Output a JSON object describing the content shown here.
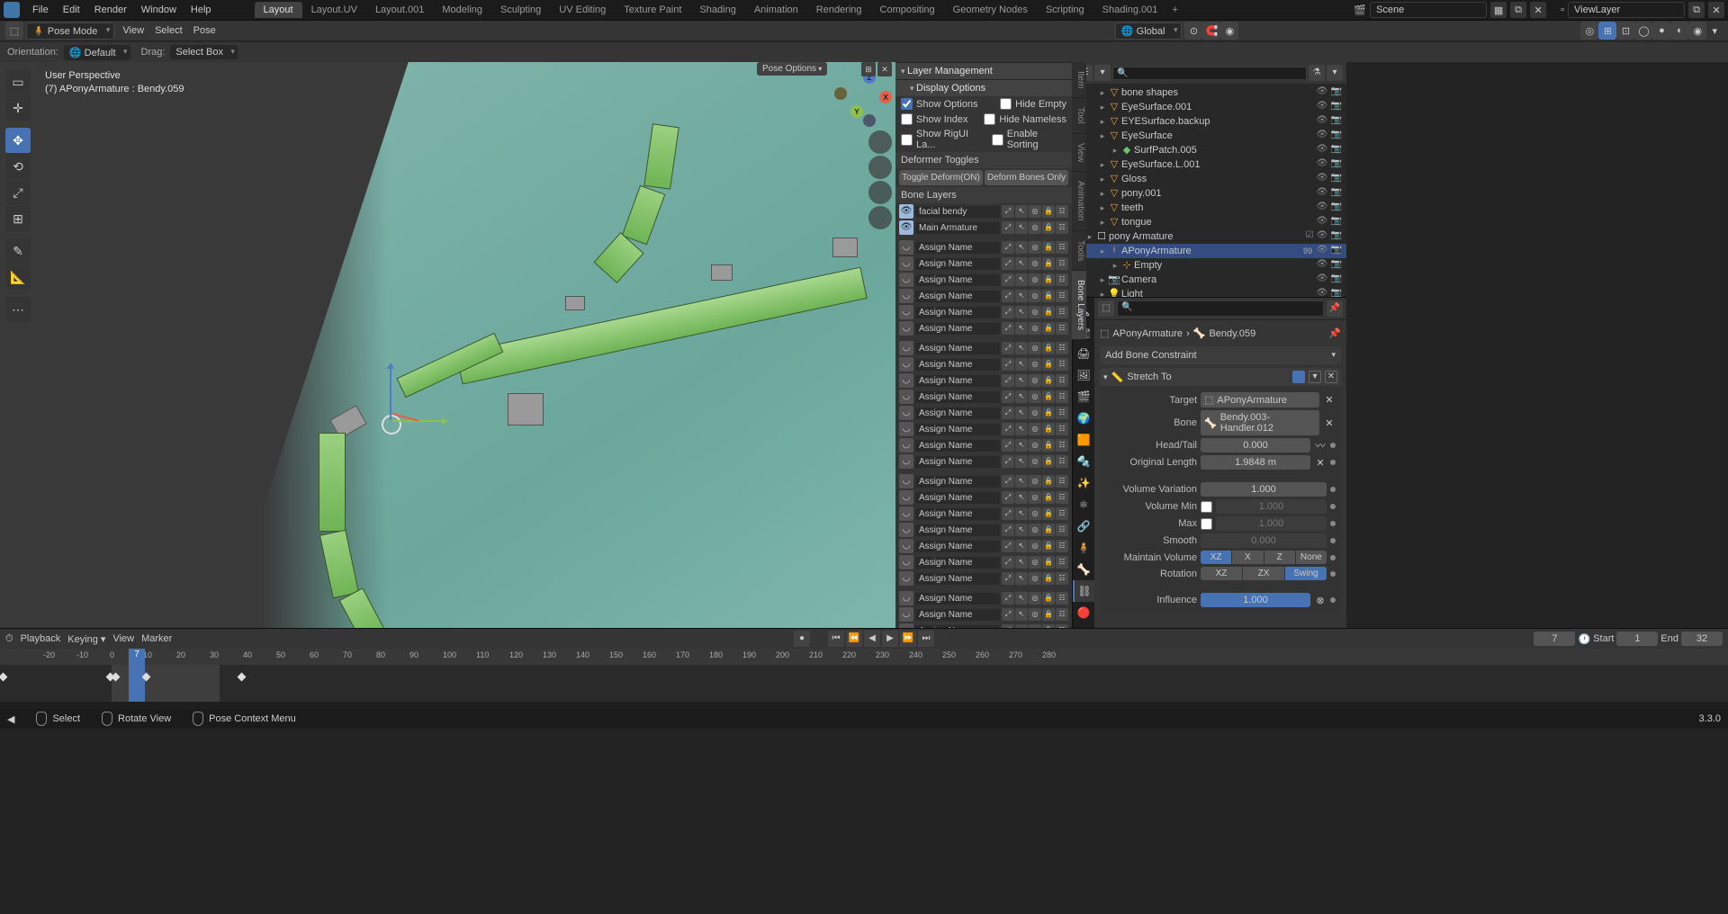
{
  "menu": {
    "file": "File",
    "edit": "Edit",
    "render": "Render",
    "window": "Window",
    "help": "Help"
  },
  "workspaces": {
    "tabs": [
      "Layout",
      "Layout.UV",
      "Layout.001",
      "Modeling",
      "Sculpting",
      "UV Editing",
      "Texture Paint",
      "Shading",
      "Animation",
      "Rendering",
      "Compositing",
      "Geometry Nodes",
      "Scripting",
      "Shading.001"
    ],
    "active": 0
  },
  "scene_name": "Scene",
  "viewlayer_name": "ViewLayer",
  "hdr": {
    "mode": "Pose Mode",
    "view": "View",
    "select": "Select",
    "pose": "Pose",
    "global": "Global"
  },
  "sub": {
    "orientation_lbl": "Orientation:",
    "orientation": "Default",
    "drag_lbl": "Drag:",
    "drag": "Select Box"
  },
  "vp": {
    "persp": "User Perspective",
    "obj": "(7) APonyArmature : Bendy.059"
  },
  "npanel": {
    "close": "✕",
    "pose_opt": "Pose Options",
    "layer_mgmt": "Layer Management",
    "display_opt": "Display Options",
    "show_options": "Show Options",
    "show_index": "Show Index",
    "show_rigui": "Show RigUI La...",
    "hide_empty": "Hide Empty",
    "hide_nameless": "Hide Nameless",
    "enable_sorting": "Enable Sorting",
    "deformer": "Deformer Toggles",
    "toggle_on": "Toggle Deform(ON)",
    "bones_only": "Deform Bones Only",
    "bone_layers": "Bone Layers",
    "layers": [
      {
        "on": true,
        "name": "facial bendy"
      },
      {
        "on": true,
        "name": "Main Armature"
      },
      {
        "on": false,
        "name": "Assign Name"
      },
      {
        "on": false,
        "name": "Assign Name"
      },
      {
        "on": false,
        "name": "Assign Name"
      },
      {
        "on": false,
        "name": "Assign Name"
      },
      {
        "on": false,
        "name": "Assign Name"
      },
      {
        "on": false,
        "name": "Assign Name"
      },
      {
        "on": false,
        "name": "Assign Name"
      },
      {
        "on": false,
        "name": "Assign Name"
      },
      {
        "on": false,
        "name": "Assign Name"
      },
      {
        "on": false,
        "name": "Assign Name"
      },
      {
        "on": false,
        "name": "Assign Name"
      },
      {
        "on": false,
        "name": "Assign Name"
      },
      {
        "on": false,
        "name": "Assign Name"
      },
      {
        "on": false,
        "name": "Assign Name"
      },
      {
        "on": false,
        "name": "Assign Name"
      },
      {
        "on": false,
        "name": "Assign Name"
      },
      {
        "on": false,
        "name": "Assign Name"
      },
      {
        "on": false,
        "name": "Assign Name"
      },
      {
        "on": false,
        "name": "Assign Name"
      },
      {
        "on": false,
        "name": "Assign Name"
      },
      {
        "on": false,
        "name": "Assign Name"
      },
      {
        "on": false,
        "name": "Assign Name"
      },
      {
        "on": false,
        "name": "Assign Name"
      },
      {
        "on": false,
        "name": "Assign Name"
      }
    ],
    "vtabs": [
      "Item",
      "Tool",
      "View",
      "Animation",
      "Tools",
      "Bone Layers"
    ]
  },
  "outliner": {
    "search": "",
    "items": [
      {
        "ind": 28,
        "ic": "▽",
        "nm": "bone shapes",
        "cols": "#e5a040"
      },
      {
        "ind": 28,
        "ic": "▽",
        "nm": "EyeSurface.001",
        "cols": "#e5a040"
      },
      {
        "ind": 28,
        "ic": "▽",
        "nm": "EYESurface.backup",
        "cols": "#e5a040"
      },
      {
        "ind": 28,
        "ic": "▽",
        "nm": "EyeSurface",
        "cols": "#e5a040"
      },
      {
        "ind": 42,
        "ic": "◆",
        "nm": "SurfPatch.005",
        "cols": "#6fc06f"
      },
      {
        "ind": 28,
        "ic": "▽",
        "nm": "EyeSurface.L.001",
        "cols": "#e5a040"
      },
      {
        "ind": 28,
        "ic": "▽",
        "nm": "Gloss",
        "cols": "#e5a040"
      },
      {
        "ind": 28,
        "ic": "▽",
        "nm": "pony.001",
        "cols": "#e5a040"
      },
      {
        "ind": 28,
        "ic": "▽",
        "nm": "teeth",
        "cols": "#e5a040"
      },
      {
        "ind": 28,
        "ic": "▽",
        "nm": "tongue",
        "cols": "#e5a040"
      },
      {
        "ind": 14,
        "ic": "☐",
        "nm": "pony Armature",
        "cols": "#ddd",
        "coll": true
      },
      {
        "ind": 28,
        "ic": "⟊",
        "nm": "APonyArmature",
        "cols": "#e5a040",
        "sel": true,
        "num": "99"
      },
      {
        "ind": 42,
        "ic": "⊹",
        "nm": "Empty",
        "cols": "#e5a040"
      },
      {
        "ind": 28,
        "ic": "📷",
        "nm": "Camera",
        "cols": "#6fc06f"
      },
      {
        "ind": 28,
        "ic": "💡",
        "nm": "Light",
        "cols": "#6fc06f"
      }
    ]
  },
  "props": {
    "breadcrumb": {
      "armature": "APonyArmature",
      "bone": "Bendy.059"
    },
    "add": "Add Bone Constraint",
    "panel": "Stretch To",
    "target_lbl": "Target",
    "target": "APonyArmature",
    "bone_lbl": "Bone",
    "bone": "Bendy.003-Handler.012",
    "headtail_lbl": "Head/Tail",
    "headtail": "0.000",
    "origlen_lbl": "Original Length",
    "origlen": "1.9848 m",
    "volvar_lbl": "Volume Variation",
    "volvar": "1.000",
    "volmin_lbl": "Volume Min",
    "volmin": "1.000",
    "max_lbl": "Max",
    "max": "1.000",
    "smooth_lbl": "Smooth",
    "smooth": "0.000",
    "maintain_lbl": "Maintain Volume",
    "mv": [
      "XZ",
      "X",
      "Z",
      "None"
    ],
    "rotation_lbl": "Rotation",
    "rot": [
      "XZ",
      "ZX",
      "Swing"
    ],
    "influence_lbl": "Influence",
    "influence": "1.000"
  },
  "timeline": {
    "playback": "Playback",
    "keying": "Keying",
    "view": "View",
    "marker": "Marker",
    "cur": "7",
    "start_lbl": "Start",
    "start": "1",
    "end_lbl": "End",
    "end": "32",
    "ticks": [
      -20,
      -10,
      0,
      10,
      20,
      30,
      40,
      50,
      60,
      70,
      80,
      90,
      100,
      110,
      120,
      130,
      140,
      150,
      160,
      170,
      180,
      190,
      200,
      210,
      220,
      230,
      240,
      250,
      260,
      270,
      280
    ]
  },
  "status": {
    "select": "Select",
    "rotate": "Rotate View",
    "ctx": "Pose Context Menu",
    "version": "3.3.0"
  }
}
